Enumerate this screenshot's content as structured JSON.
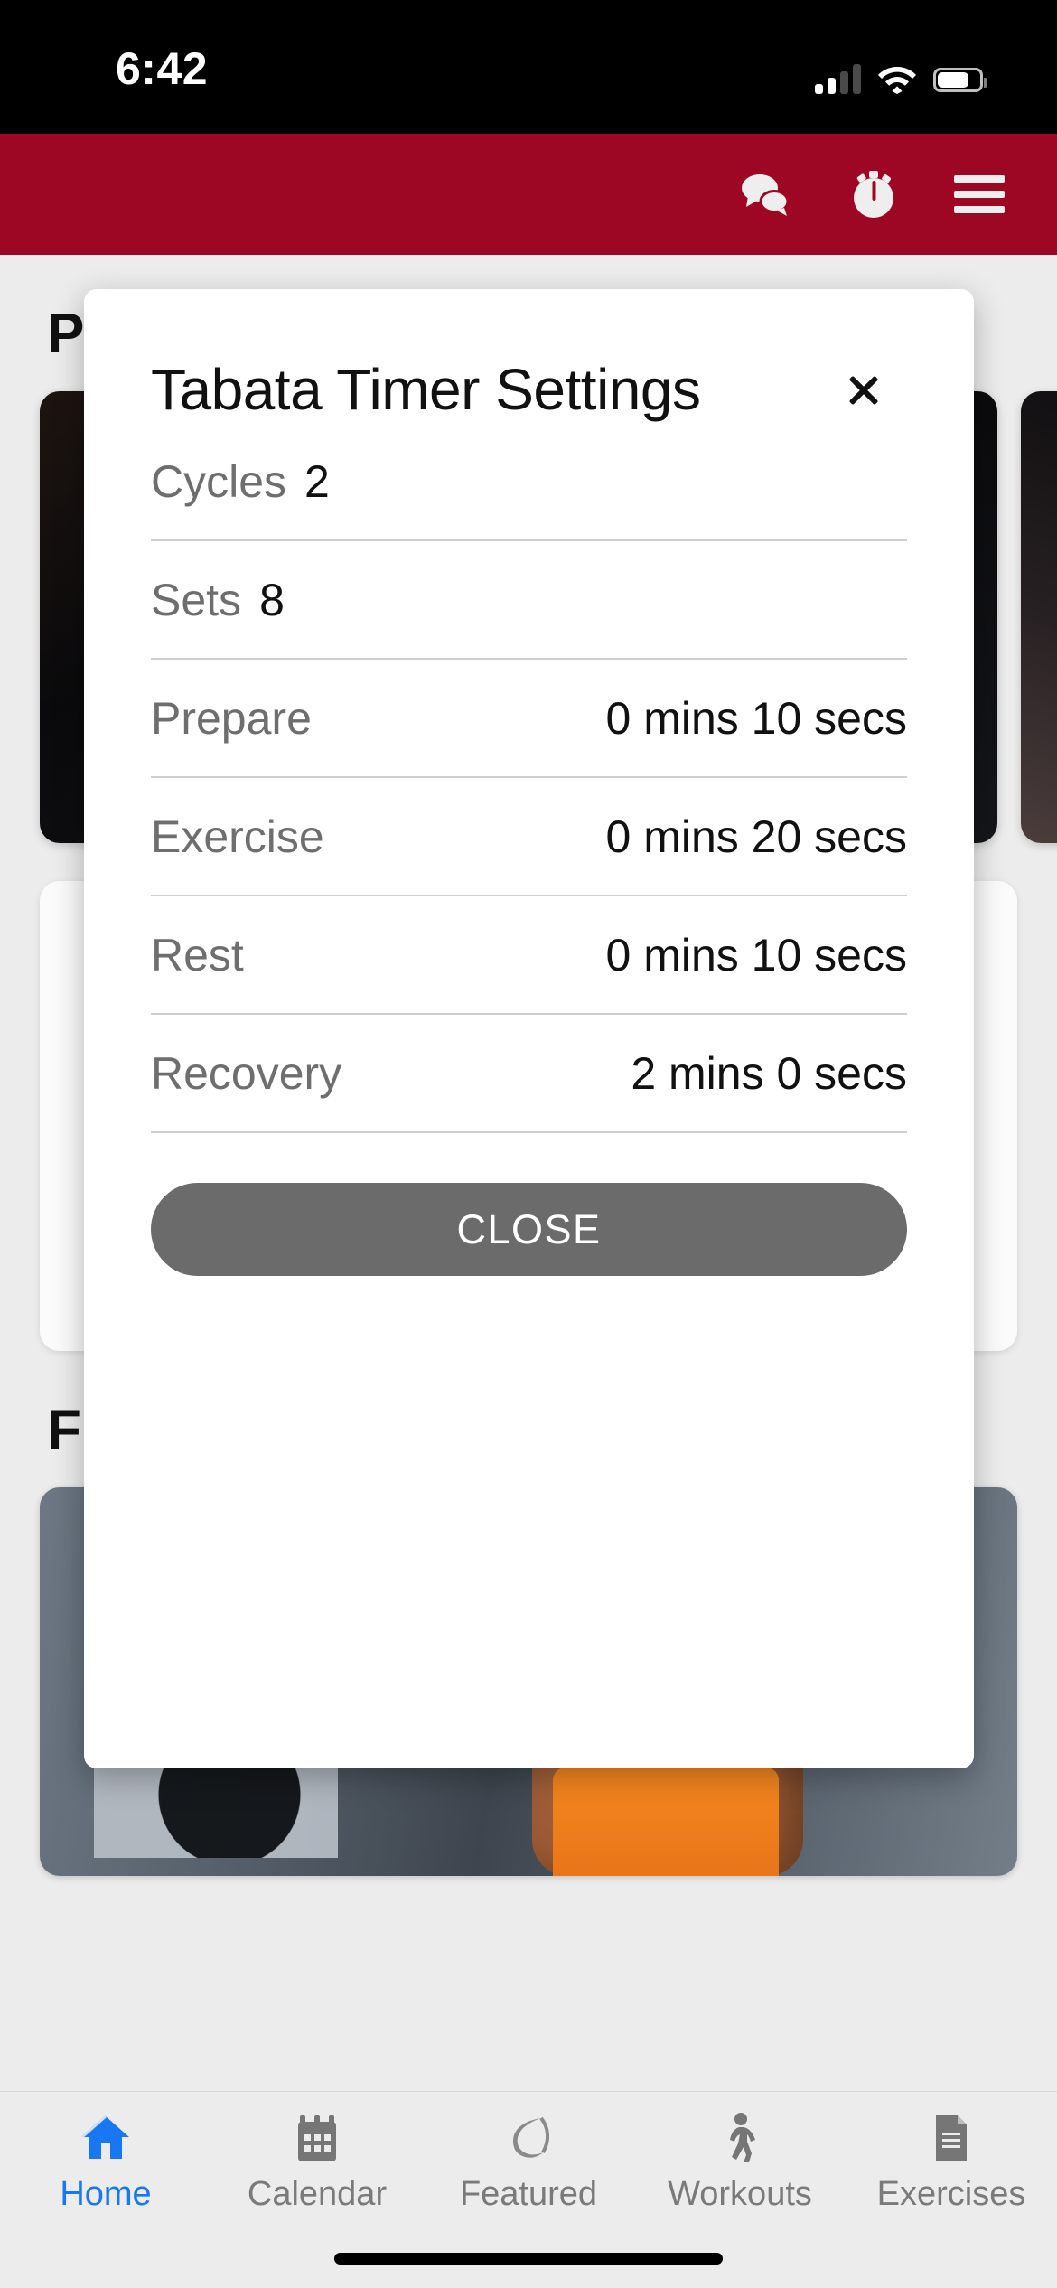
{
  "status_bar": {
    "time": "6:42",
    "signal_icon": "cellular-signal-icon",
    "signal_bars_filled": 2,
    "signal_bars_total": 4,
    "wifi_icon": "wifi-icon",
    "battery_icon": "battery-icon",
    "battery_percent": 72
  },
  "app_bar": {
    "background_color": "#9d0723",
    "actions": [
      {
        "name": "chat-icon",
        "label": "Chat"
      },
      {
        "name": "timer-icon",
        "label": "Timer"
      },
      {
        "name": "menu-icon",
        "label": "Menu"
      }
    ]
  },
  "page": {
    "section_one_title": "P",
    "section_two_title": "F"
  },
  "modal": {
    "title": "Tabata Timer Settings",
    "close_icon": "close-icon",
    "rows": [
      {
        "label": "Cycles",
        "value": "2",
        "layout": "inline"
      },
      {
        "label": "Sets",
        "value": "8",
        "layout": "inline"
      },
      {
        "label": "Prepare",
        "value": "0 mins 10 secs",
        "layout": "spread"
      },
      {
        "label": "Exercise",
        "value": "0 mins 20 secs",
        "layout": "spread"
      },
      {
        "label": "Rest",
        "value": "0 mins 10 secs",
        "layout": "spread"
      },
      {
        "label": "Recovery",
        "value": "2 mins 0 secs",
        "layout": "spread"
      }
    ],
    "close_button_label": "CLOSE",
    "close_button_color": "#6b6b6b"
  },
  "tab_bar": {
    "active_color": "#1877f2",
    "inactive_color": "#7a7a7a",
    "tabs": [
      {
        "label": "Home",
        "icon": "home-icon",
        "active": true
      },
      {
        "label": "Calendar",
        "icon": "calendar-icon",
        "active": false
      },
      {
        "label": "Featured",
        "icon": "featured-icon",
        "active": false
      },
      {
        "label": "Workouts",
        "icon": "walking-icon",
        "active": false
      },
      {
        "label": "Exercises",
        "icon": "document-icon",
        "active": false
      }
    ]
  }
}
